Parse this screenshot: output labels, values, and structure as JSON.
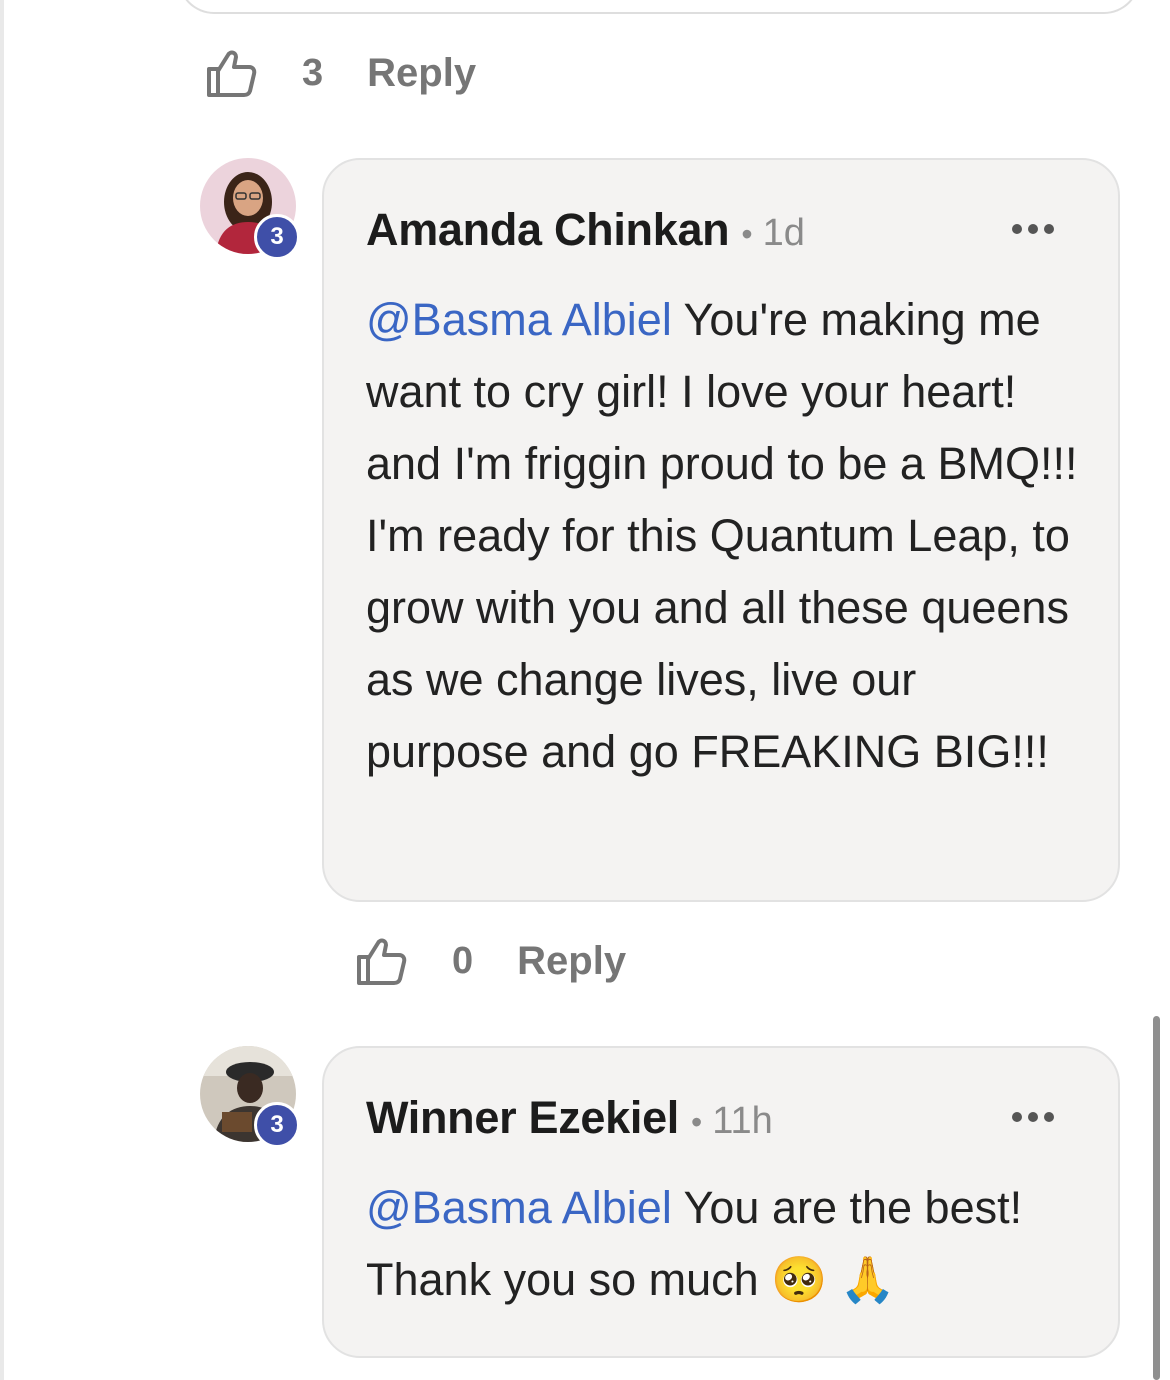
{
  "previous": {
    "like_count": "3",
    "reply_label": "Reply"
  },
  "comments": [
    {
      "author": "Amanda Chinkan",
      "time": "1d",
      "badge": "3",
      "mention": "@Basma Albiel",
      "text": " You're making me want to cry girl! I love your heart! and I'm friggin proud to be a BMQ!!! I'm ready for this Quantum Leap, to grow with you and all these queens as we change lives, live our purpose and go FREAKING BIG!!!",
      "like_count": "0",
      "reply_label": "Reply"
    },
    {
      "author": "Winner Ezekiel",
      "time": "11h",
      "badge": "3",
      "mention": "@Basma Albiel",
      "text": " You are the best! Thank you so much 🥺 🙏"
    }
  ],
  "meta_separator": "•",
  "colors": {
    "mention": "#3a66c4",
    "badge": "#3f4fa8",
    "bubble": "#f4f3f2",
    "muted": "#767676"
  },
  "icons": [
    "thumbs-up-icon",
    "more-dots-icon",
    "avatar-icon"
  ]
}
